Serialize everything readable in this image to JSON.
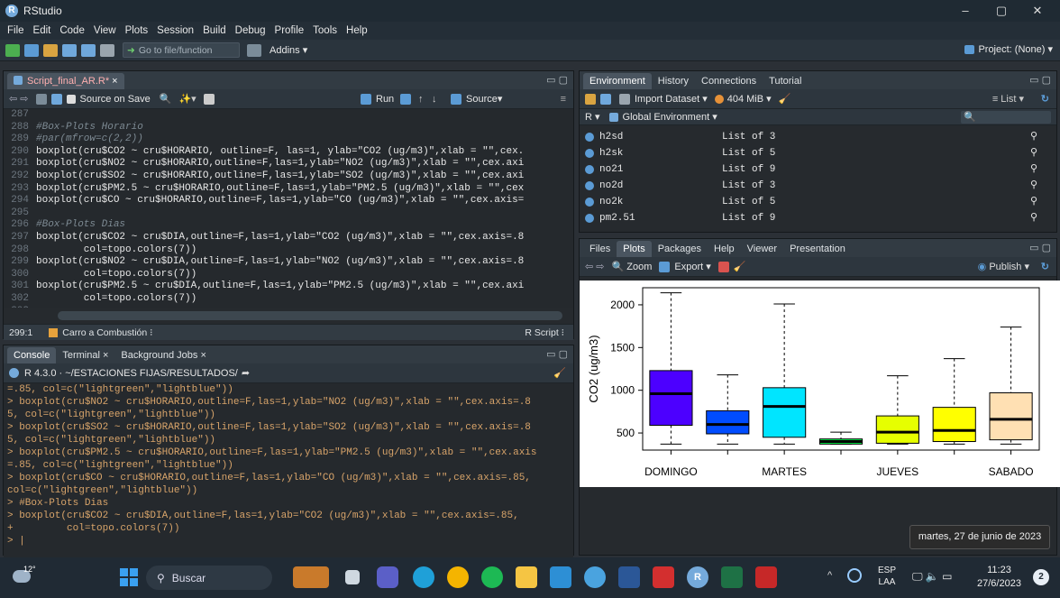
{
  "window": {
    "title": "RStudio",
    "controls": [
      "–",
      "▢",
      "✕"
    ]
  },
  "menu": [
    "File",
    "Edit",
    "Code",
    "View",
    "Plots",
    "Session",
    "Build",
    "Debug",
    "Profile",
    "Tools",
    "Help"
  ],
  "toolbar": {
    "goto_placeholder": "Go to file/function",
    "addins": "Addins",
    "project": "Project: (None)"
  },
  "editor": {
    "tab": "Script_final_AR.R*",
    "source_on_save": "Source on Save",
    "run": "Run",
    "source": "Source",
    "lines": [
      {
        "n": "287",
        "t": ""
      },
      {
        "n": "288",
        "t": "#Box-Plots Horario",
        "c": "cmt"
      },
      {
        "n": "289",
        "t": "#par(mfrow=c(2,2))",
        "c": "cmt"
      },
      {
        "n": "290",
        "t": "boxplot(cru$CO2 ~ cru$HORARIO, outline=F, las=1, ylab=\"CO2 (ug/m3)\",xlab = \"\",cex."
      },
      {
        "n": "291",
        "t": "boxplot(cru$NO2 ~ cru$HORARIO,outline=F,las=1,ylab=\"NO2 (ug/m3)\",xlab = \"\",cex.axi"
      },
      {
        "n": "292",
        "t": "boxplot(cru$SO2 ~ cru$HORARIO,outline=F,las=1,ylab=\"SO2 (ug/m3)\",xlab = \"\",cex.axi"
      },
      {
        "n": "293",
        "t": "boxplot(cru$PM2.5 ~ cru$HORARIO,outline=F,las=1,ylab=\"PM2.5 (ug/m3)\",xlab = \"\",cex"
      },
      {
        "n": "294",
        "t": "boxplot(cru$CO ~ cru$HORARIO,outline=F,las=1,ylab=\"CO (ug/m3)\",xlab = \"\",cex.axis="
      },
      {
        "n": "295",
        "t": ""
      },
      {
        "n": "296",
        "t": "#Box-Plots Dias",
        "c": "cmt"
      },
      {
        "n": "297",
        "t": "boxplot(cru$CO2 ~ cru$DIA,outline=F,las=1,ylab=\"CO2 (ug/m3)\",xlab = \"\",cex.axis=.8"
      },
      {
        "n": "298",
        "t": "        col=topo.colors(7))"
      },
      {
        "n": "299",
        "t": "boxplot(cru$NO2 ~ cru$DIA,outline=F,las=1,ylab=\"NO2 (ug/m3)\",xlab = \"\",cex.axis=.8"
      },
      {
        "n": "300",
        "t": "        col=topo.colors(7))"
      },
      {
        "n": "301",
        "t": "boxplot(cru$PM2.5 ~ cru$DIA,outline=F,las=1,ylab=\"PM2.5 (ug/m3)\",xlab = \"\",cex.axi"
      },
      {
        "n": "302",
        "t": "        col=topo.colors(7))"
      },
      {
        "n": "303",
        "t": ""
      }
    ],
    "status_pos": "299:1",
    "status_section": "Carro a Combustión",
    "status_type": "R Script"
  },
  "console": {
    "tabs": [
      "Console",
      "Terminal",
      "Background Jobs"
    ],
    "path": "R 4.3.0 · ~/ESTACIONES FIJAS/RESULTADOS/",
    "lines": [
      "=.85, col=c(\"lightgreen\",\"lightblue\"))",
      "> boxplot(cru$NO2 ~ cru$HORARIO,outline=F,las=1,ylab=\"NO2 (ug/m3)\",xlab = \"\",cex.axis=.8",
      "5, col=c(\"lightgreen\",\"lightblue\"))",
      "> boxplot(cru$SO2 ~ cru$HORARIO,outline=F,las=1,ylab=\"SO2 (ug/m3)\",xlab = \"\",cex.axis=.8",
      "5, col=c(\"lightgreen\",\"lightblue\"))",
      "> boxplot(cru$PM2.5 ~ cru$HORARIO,outline=F,las=1,ylab=\"PM2.5 (ug/m3)\",xlab = \"\",cex.axis",
      "=.85, col=c(\"lightgreen\",\"lightblue\"))",
      "> boxplot(cru$CO ~ cru$HORARIO,outline=F,las=1,ylab=\"CO (ug/m3)\",xlab = \"\",cex.axis=.85,",
      "col=c(\"lightgreen\",\"lightblue\"))",
      "> #Box-Plots Dias",
      "> boxplot(cru$CO2 ~ cru$DIA,outline=F,las=1,ylab=\"CO2 (ug/m3)\",xlab = \"\",cex.axis=.85,",
      "+         col=topo.colors(7))",
      "> |"
    ]
  },
  "environment": {
    "tabs": [
      "Environment",
      "History",
      "Connections",
      "Tutorial"
    ],
    "import": "Import Dataset",
    "memory": "404 MiB",
    "list_label": "List",
    "scope": "Global Environment",
    "lang": "R",
    "rows": [
      {
        "name": "h2sd",
        "value": "List of  3"
      },
      {
        "name": "h2sk",
        "value": "List of  5"
      },
      {
        "name": "no21",
        "value": "List of  9"
      },
      {
        "name": "no2d",
        "value": "List of  3"
      },
      {
        "name": "no2k",
        "value": "List of  5"
      },
      {
        "name": "pm2.51",
        "value": "List of  9"
      }
    ]
  },
  "files": {
    "tabs": [
      "Files",
      "Plots",
      "Packages",
      "Help",
      "Viewer",
      "Presentation"
    ],
    "zoom": "Zoom",
    "export": "Export",
    "publish": "Publish"
  },
  "chart_data": {
    "type": "boxplot",
    "ylabel": "CO2 (ug/m3)",
    "ylim": [
      300,
      2200
    ],
    "yticks": [
      500,
      1000,
      1500,
      2000
    ],
    "xtick_labels_shown": [
      "DOMINGO",
      "MARTES",
      "JUEVES",
      "SABADO"
    ],
    "boxes": [
      {
        "whisker_low": 370,
        "q1": 590,
        "median": 960,
        "q3": 1230,
        "whisker_high": 2140,
        "color": "#4c00ff"
      },
      {
        "whisker_low": 370,
        "q1": 490,
        "median": 600,
        "q3": 760,
        "whisker_high": 1180,
        "color": "#004cff"
      },
      {
        "whisker_low": 370,
        "q1": 450,
        "median": 810,
        "q3": 1030,
        "whisker_high": 2010,
        "color": "#00e5ff"
      },
      {
        "whisker_low": 370,
        "q1": 370,
        "median": 400,
        "q3": 430,
        "whisker_high": 510,
        "color": "#00ff4d"
      },
      {
        "whisker_low": 370,
        "q1": 380,
        "median": 510,
        "q3": 700,
        "whisker_high": 1170,
        "color": "#e6ff00"
      },
      {
        "whisker_low": 370,
        "q1": 400,
        "median": 530,
        "q3": 800,
        "whisker_high": 1370,
        "color": "#ffff00"
      },
      {
        "whisker_low": 370,
        "q1": 420,
        "median": 660,
        "q3": 970,
        "whisker_high": 1740,
        "color": "#ffe0b3"
      }
    ]
  },
  "tooltip": "martes, 27 de junio de 2023",
  "taskbar": {
    "weather": "12°",
    "search": "Buscar",
    "lang": "ESP",
    "layout": "LAA",
    "time": "11:23",
    "date": "27/6/2023",
    "notif": "2"
  }
}
